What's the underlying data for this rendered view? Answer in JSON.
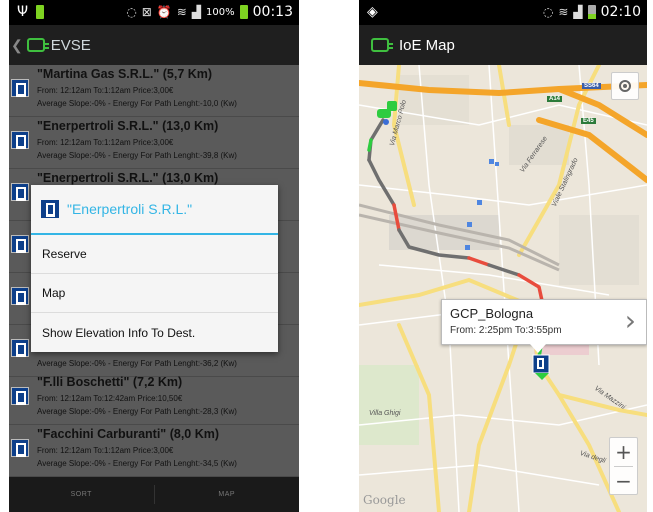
{
  "left_screen": {
    "status": {
      "battery_pct": "100%",
      "time": "00:13"
    },
    "action_bar": {
      "title": "EVSE"
    },
    "items": [
      {
        "name": "\"Martina Gas S.R.L.\" (5,7 Km)",
        "line2": "From: 12:12am To:1:12am Price:3,00€",
        "line3": "Average Slope:-0% - Energy For Path Lenght:-10,0 (Kw)"
      },
      {
        "name": "\"Enerpertroli S.R.L.\" (13,0 Km)",
        "line2": "From: 12:12am To:1:12am Price:3,00€",
        "line3": "Average Slope:-0% - Energy For Path Lenght:-39,8 (Kw)"
      },
      {
        "name": "\"Enerpertroli S.R.L.\" (13,0 Km)",
        "line2": "",
        "line3": ""
      },
      {
        "name": "",
        "line2": "",
        "line3": ""
      },
      {
        "name": "",
        "line2": "",
        "line3": ""
      },
      {
        "name": "",
        "line2": "",
        "line3": "Average Slope:-0% - Energy For Path Lenght:-36,2 (Kw)"
      },
      {
        "name": "\"F.lli Boschetti\" (7,2 Km)",
        "line2": "From: 12:12am To:12:42am Price:10,50€",
        "line3": "Average Slope:-0% - Energy For Path Lenght:-28,3 (Kw)"
      },
      {
        "name": "\"Facchini Carburanti\" (8,0 Km)",
        "line2": "From: 12:12am To:1:12am Price:3,00€",
        "line3": "Average Slope:-0% - Energy For Path Lenght:-34,5 (Kw)"
      }
    ],
    "dialog": {
      "title": "\"Enerpertroli S.R.L.\"",
      "options": [
        "Reserve",
        "Map",
        "Show Elevation Info To Dest."
      ]
    },
    "bottom_bar": {
      "sort_label": "SORT",
      "map_label": "MAP"
    }
  },
  "right_screen": {
    "status": {
      "time": "02:10"
    },
    "action_bar": {
      "title": "IoE Map"
    },
    "map": {
      "google_label": "Google",
      "road_labels": {
        "via_marco_polo": "Via Marco Polo",
        "via_ferrarese": "Via Ferrarese",
        "viale_stalingrado": "Viale Stalingrado",
        "via_mazzini": "Via Mazzini",
        "via_degli": "Via degli",
        "villa_ghigi": "Villa Ghigi"
      },
      "shields": {
        "a14": "A14",
        "ss64": "SS64",
        "e45": "E45"
      },
      "info_window": {
        "title": "GCP_Bologna",
        "subtitle": "From: 2:25pm To:3:55pm"
      },
      "zoom_in": "+",
      "zoom_out": "−"
    }
  },
  "icons": {
    "usb": "usb-icon",
    "mute": "mute-icon",
    "wifi": "wifi-icon",
    "signal": "signal-icon",
    "battery": "battery-icon",
    "location": "location-icon",
    "ev": "ev-logo-icon",
    "pump": "charging-station-icon"
  },
  "colors": {
    "accent_blue": "#33b5e5",
    "ev_green": "#3fbf3f",
    "route_gray": "#6f6f6f",
    "route_red": "#e84c3d",
    "route_green": "#2ecc40",
    "highway_orange": "#f4a52a"
  }
}
